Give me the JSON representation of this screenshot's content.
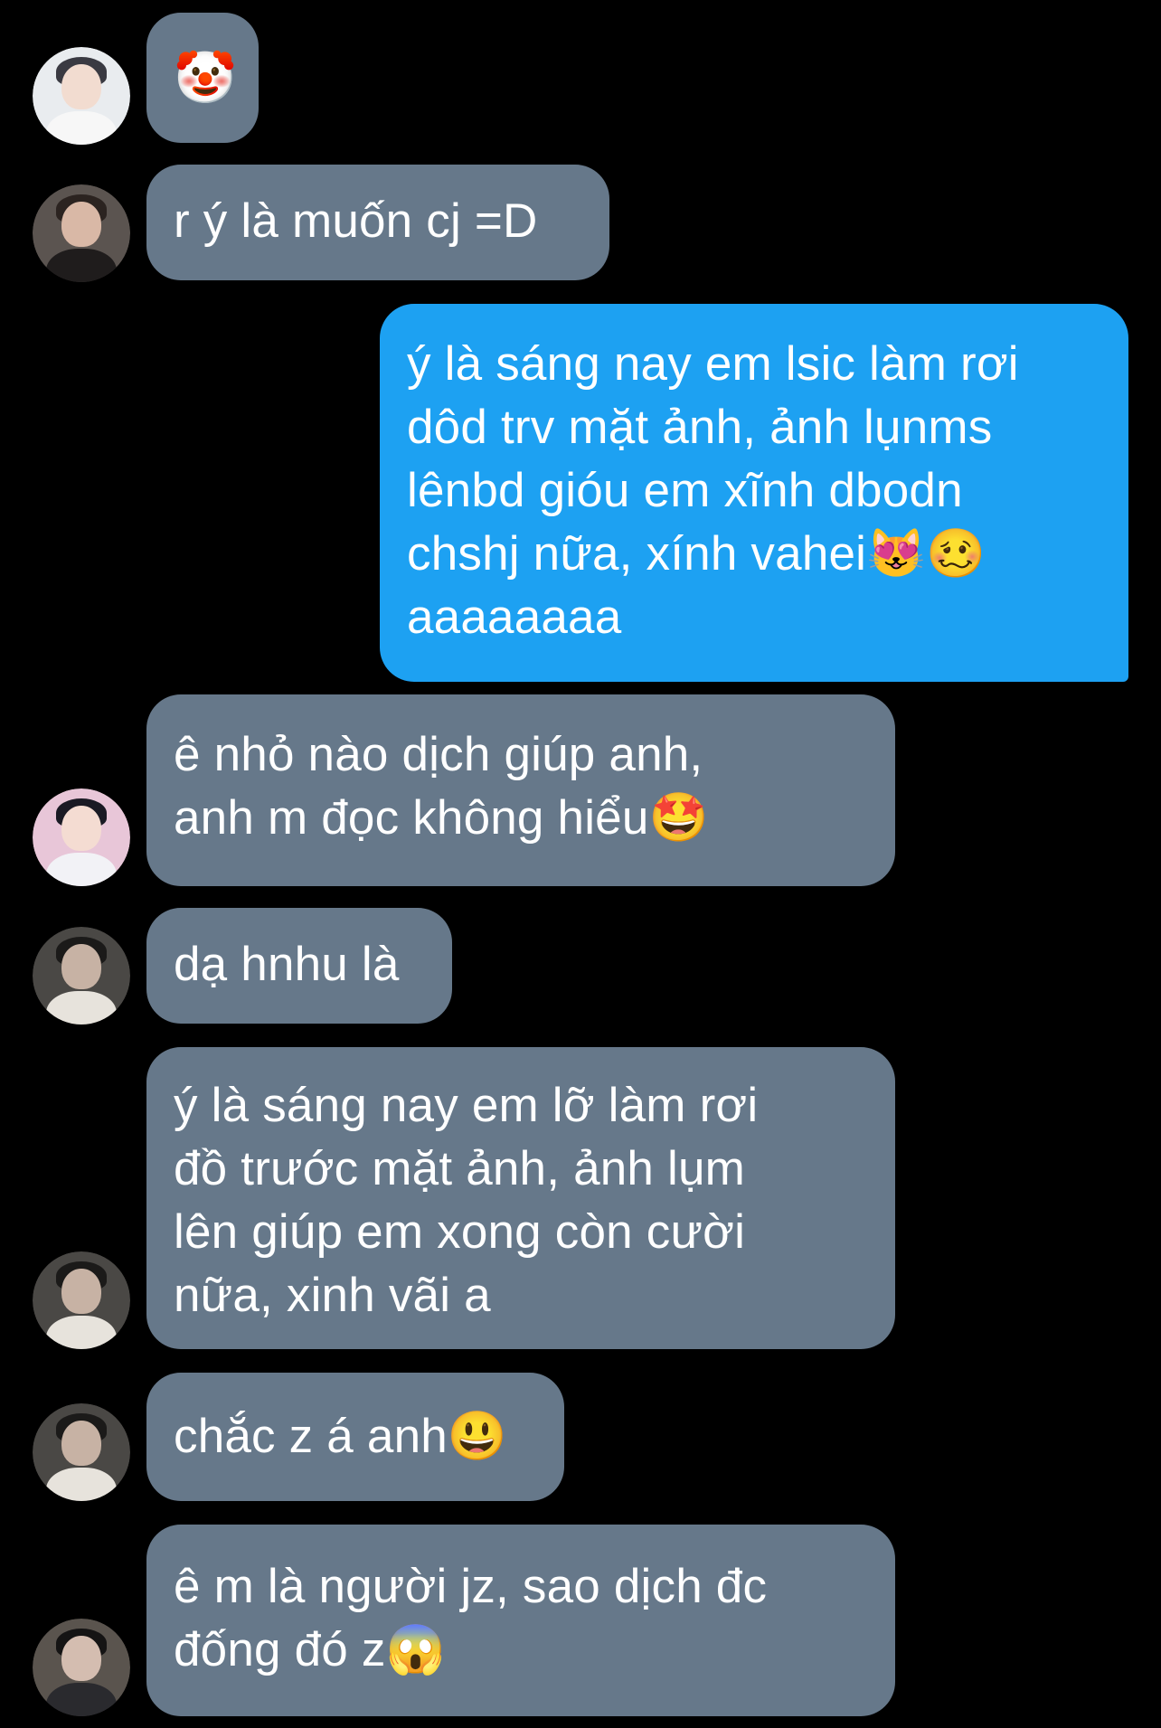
{
  "conversation": {
    "messages": [
      {
        "id": "m1",
        "direction": "incoming",
        "text": "🤡",
        "avatar": "avatar-1"
      },
      {
        "id": "m2",
        "direction": "incoming",
        "text": "r ý là muốn cj =D",
        "avatar": "avatar-2"
      },
      {
        "id": "m3",
        "direction": "outgoing",
        "text": "ý là sáng nay em lsic làm rơi\ndôd trv mặt ảnh, ảnh lụnms\nlênbd gióu em xĩnh dbodn\nchshj nữa, xính vahei😻🥴\naaaaaaaa"
      },
      {
        "id": "m4",
        "direction": "incoming",
        "text": "ê nhỏ nào dịch giúp anh,\nanh m đọc không hiểu🤩",
        "avatar": "avatar-3"
      },
      {
        "id": "m5",
        "direction": "incoming",
        "text": "dạ hnhu là",
        "avatar": "avatar-4"
      },
      {
        "id": "m6",
        "direction": "incoming",
        "text": "ý là sáng nay em lỡ làm rơi\nđồ trước mặt ảnh, ảnh lụm\nlên giúp em xong còn cười\nnữa, xinh vãi a",
        "avatar": "avatar-4"
      },
      {
        "id": "m7",
        "direction": "incoming",
        "text": "chắc z á anh😃",
        "avatar": "avatar-4"
      },
      {
        "id": "m8",
        "direction": "incoming",
        "text": "ê m là người jz, sao dịch đc\nđống đó z😱",
        "avatar": "avatar-5"
      }
    ]
  },
  "colors": {
    "background": "#000000",
    "incoming_bubble": "#66788a",
    "outgoing_bubble": "#1da1f2",
    "text": "#ffffff"
  }
}
